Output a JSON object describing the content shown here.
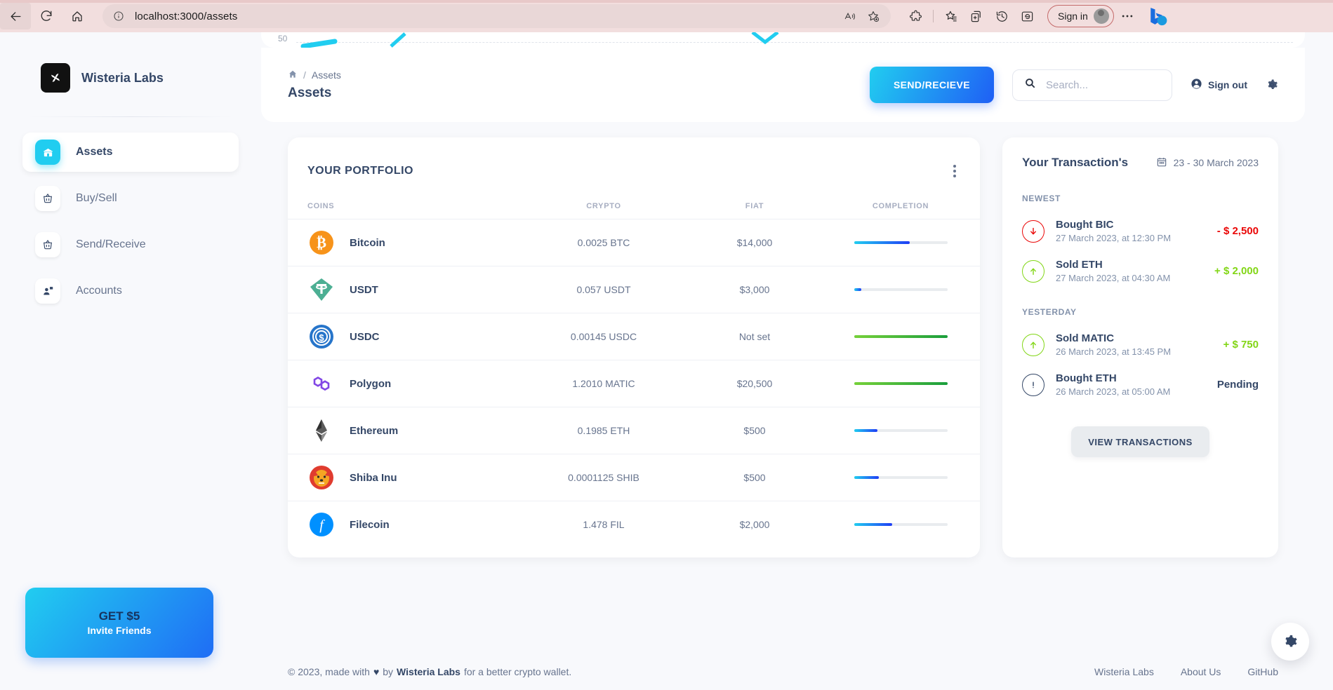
{
  "browser": {
    "url": "localhost:3000/assets",
    "back_label": "Back",
    "refresh_label": "Refresh",
    "home_label": "Home",
    "read_aloud_label": "Read aloud",
    "favorite_label": "Add to favorites",
    "extensions_label": "Extensions",
    "collections_label": "Collections",
    "split_label": "Split screen",
    "history_label": "History",
    "ie_label": "Internet Explorer mode",
    "signin_label": "Sign in",
    "settings_label": "Settings and more",
    "copilot_label": "Bing Chat"
  },
  "sidebar": {
    "brand": "Wisteria Labs",
    "items": [
      {
        "label": "Assets",
        "icon": "wallet-icon",
        "active": true
      },
      {
        "label": "Buy/Sell",
        "icon": "basket-icon",
        "active": false
      },
      {
        "label": "Send/Receive",
        "icon": "basket-icon",
        "active": false
      },
      {
        "label": "Accounts",
        "icon": "person-badge-icon",
        "active": false
      }
    ],
    "promo": {
      "title": "GET $5",
      "subtitle": "Invite Friends"
    }
  },
  "header": {
    "breadcrumb_home": "home-icon",
    "breadcrumb_sep": "/",
    "breadcrumb_current": "Assets",
    "page_title": "Assets",
    "primary_button": "SEND/RECIEVE",
    "search_placeholder": "Search...",
    "search_value": "",
    "signout_label": "Sign out",
    "settings_icon": "gear-icon"
  },
  "chart_sliver": {
    "axis_label": "50"
  },
  "portfolio": {
    "title": "YOUR PORTFOLIO",
    "menu_icon": "kebab-menu-icon",
    "columns": [
      "COINS",
      "CRYPTO",
      "FIAT",
      "COMPLETION"
    ],
    "rows": [
      {
        "coin": "Bitcoin",
        "symbol": "BTC",
        "crypto": "0.0025 BTC",
        "fiat": "$14,000",
        "completion": 60,
        "color": "blue"
      },
      {
        "coin": "USDT",
        "symbol": "USDT",
        "crypto": "0.057 USDT",
        "fiat": "$3,000",
        "completion": 8,
        "color": "blue"
      },
      {
        "coin": "USDC",
        "symbol": "USDC",
        "crypto": "0.00145 USDC",
        "fiat": "Not set",
        "completion": 100,
        "color": "green"
      },
      {
        "coin": "Polygon",
        "symbol": "MATIC",
        "crypto": "1.2010 MATIC",
        "fiat": "$20,500",
        "completion": 100,
        "color": "green"
      },
      {
        "coin": "Ethereum",
        "symbol": "ETH",
        "crypto": "0.1985 ETH",
        "fiat": "$500",
        "completion": 25,
        "color": "blue"
      },
      {
        "coin": "Shiba Inu",
        "symbol": "SHIB",
        "crypto": "0.0001125 SHIB",
        "fiat": "$500",
        "completion": 27,
        "color": "blue"
      },
      {
        "coin": "Filecoin",
        "symbol": "FIL",
        "crypto": "1.478 FIL",
        "fiat": "$2,000",
        "completion": 41,
        "color": "blue"
      }
    ]
  },
  "transactions": {
    "title": "Your Transaction's",
    "date_range": "23 - 30 March 2023",
    "calendar_icon": "calendar-icon",
    "groups": [
      {
        "label": "NEWEST",
        "items": [
          {
            "name": "Bought BIC",
            "time": "27 March 2023, at 12:30 PM",
            "amount": "- $ 2,500",
            "direction": "down",
            "state": "negative"
          },
          {
            "name": "Sold ETH",
            "time": "27 March 2023, at 04:30 AM",
            "amount": "+ $ 2,000",
            "direction": "up",
            "state": "positive"
          }
        ]
      },
      {
        "label": "YESTERDAY",
        "items": [
          {
            "name": "Sold MATIC",
            "time": "26 March 2023, at 13:45 PM",
            "amount": "+ $ 750",
            "direction": "up",
            "state": "positive"
          },
          {
            "name": "Bought ETH",
            "time": "26 March 2023, at 05:00 AM",
            "amount": "Pending",
            "direction": "pending",
            "state": "pending"
          }
        ]
      }
    ],
    "cta": "VIEW TRANSACTIONS"
  },
  "footer": {
    "copyright_pre": "© 2023, made with",
    "heart": "♥",
    "copyright_by": "by",
    "brand": "Wisteria Labs",
    "copyright_post": "for a better crypto wallet.",
    "links": [
      "Wisteria Labs",
      "About Us",
      "GitHub"
    ],
    "fab_icon": "gear-icon"
  },
  "colors": {
    "accent_blue": "#21cdf0",
    "accent_indigo": "#1f5ff5",
    "positive": "#82d616",
    "negative": "#ea0606",
    "text_dark": "#344767",
    "text_muted": "#67748e"
  }
}
